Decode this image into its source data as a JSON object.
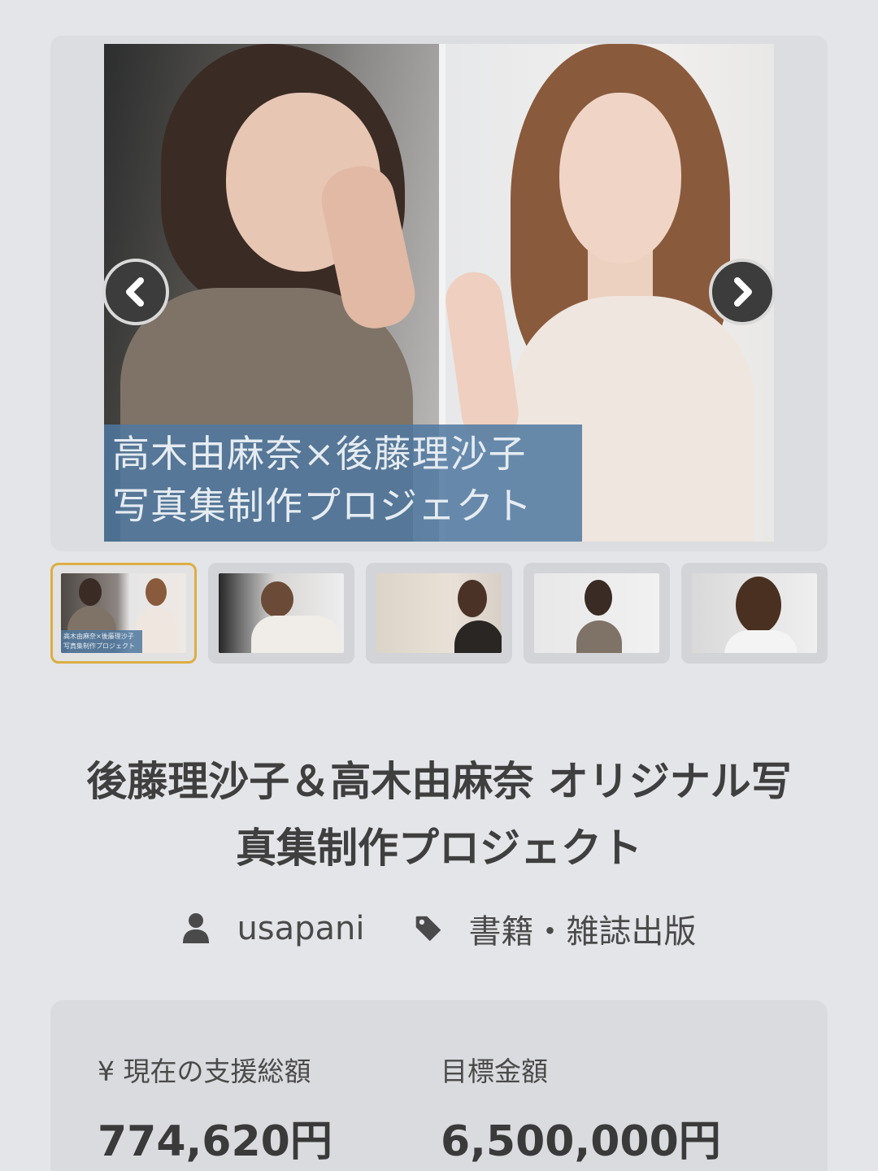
{
  "carousel": {
    "caption_line1": "高木由麻奈×後藤理沙子",
    "caption_line2": "写真集制作プロジェクト",
    "prev_icon": "chevron-left-icon",
    "next_icon": "chevron-right-icon"
  },
  "thumbnails": [
    {
      "caption1": "高木由麻奈×後藤理沙子",
      "caption2": "写真集制作プロジェクト",
      "active": true
    },
    {
      "active": false
    },
    {
      "active": false
    },
    {
      "active": false
    },
    {
      "active": false
    }
  ],
  "project": {
    "title_line1": "後藤理沙子＆高木由麻奈 オリジナル写",
    "title_line2": "真集制作プロジェクト",
    "owner": "usapani",
    "owner_icon": "user-icon",
    "category": "書籍・雑誌出版",
    "category_icon": "tag-icon"
  },
  "funding": {
    "current_label": "¥ 現在の支援総額",
    "current_value": "774,620円",
    "goal_label": "目標金額",
    "goal_value": "6,500,000円"
  },
  "colors": {
    "background": "#e4e5e8",
    "active_thumb_border": "#dcae44",
    "caption_bg": "#4f78a0"
  }
}
